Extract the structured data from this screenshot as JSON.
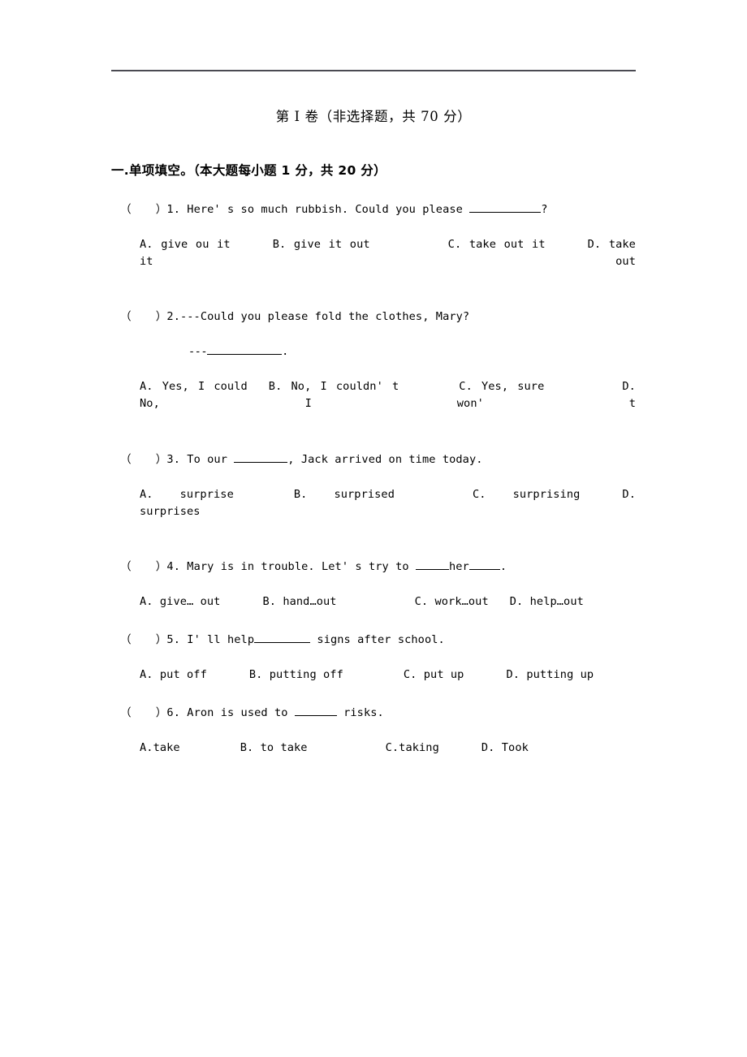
{
  "document": {
    "paper_title": "第 I 卷（非选择题，共 70 分）",
    "section_heading": "一.单项填空。（本大题每小题 1 分，共 20 分）"
  },
  "questions": [
    {
      "marker_open": "（",
      "marker_close": "）",
      "number": "1.",
      "stem_before": "Here' s so much rubbish. Could you please ",
      "stem_after": "?",
      "options": [
        {
          "letter": "A.",
          "text": "give ou it"
        },
        {
          "letter": "B.",
          "text": "give it out"
        },
        {
          "letter": "C.",
          "text": "take out it"
        },
        {
          "letter": "D.",
          "text": "take it out"
        }
      ]
    },
    {
      "marker_open": "（",
      "marker_close": "）",
      "number": "2.",
      "stem_before": "---Could you please fold the clothes, Mary?",
      "answer_dashes": "---",
      "answer_after": ".",
      "options": [
        {
          "letter": "A.",
          "text": "Yes, I could"
        },
        {
          "letter": "B.",
          "text": "No, I couldn' t"
        },
        {
          "letter": "C.",
          "text": "Yes, sure"
        },
        {
          "letter": "D.",
          "text": "No, I won' t"
        }
      ]
    },
    {
      "marker_open": "（",
      "marker_close": "）",
      "number": "3.",
      "stem_before": "To our ",
      "stem_after": ", Jack arrived on time today.",
      "options": [
        {
          "letter": "A.",
          "text": "surprise"
        },
        {
          "letter": "B.",
          "text": "surprised"
        },
        {
          "letter": "C.",
          "text": "surprising"
        },
        {
          "letter": "D.",
          "text": "surprises"
        }
      ]
    },
    {
      "marker_open": "（",
      "marker_close": "）",
      "number": "4.",
      "stem_before": "Mary is in trouble. Let' s try to ",
      "stem_middle": "her",
      "stem_after": ".",
      "options": [
        {
          "letter": "A.",
          "text": "give… out"
        },
        {
          "letter": "B.",
          "text": "hand…out"
        },
        {
          "letter": "C.",
          "text": "work…out"
        },
        {
          "letter": "D.",
          "text": "help…out"
        }
      ]
    },
    {
      "marker_open": "（",
      "marker_close": "）",
      "number": "5.",
      "stem_before": "I' ll help",
      "stem_after": " signs after school.",
      "options": [
        {
          "letter": "A.",
          "text": "put off"
        },
        {
          "letter": "B.",
          "text": "putting off"
        },
        {
          "letter": "C.",
          "text": "put up"
        },
        {
          "letter": "D.",
          "text": "putting up"
        }
      ]
    },
    {
      "marker_open": "（",
      "marker_close": "）",
      "number": "6.",
      "stem_before": "Aron is used to ",
      "stem_after": " risks.",
      "options": [
        {
          "letter": "A.",
          "text": "take"
        },
        {
          "letter": "B.",
          "text": "to take"
        },
        {
          "letter": "C.",
          "text": "taking"
        },
        {
          "letter": "D.",
          "text": "Took"
        }
      ]
    }
  ]
}
